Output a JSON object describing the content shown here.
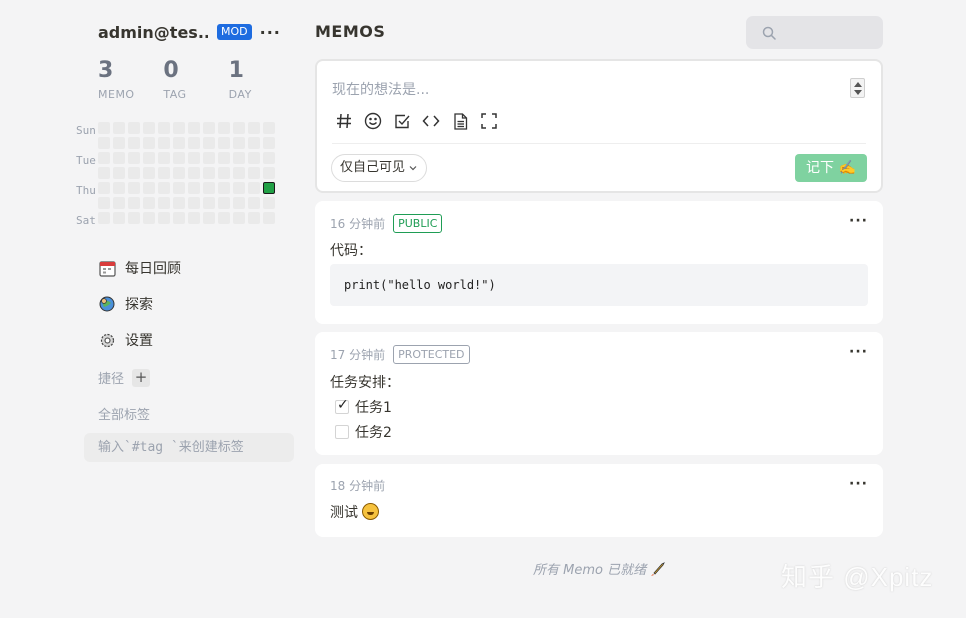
{
  "user": {
    "name": "admin@tes...",
    "role_badge": "MOD",
    "more_label": "···"
  },
  "stats": [
    {
      "value": "3",
      "label": "MEMO"
    },
    {
      "value": "0",
      "label": "TAG"
    },
    {
      "value": "1",
      "label": "DAY"
    }
  ],
  "heatmap": {
    "weekday_labels": [
      "Sun",
      "Tue",
      "Thu",
      "Sat"
    ],
    "rows": 7,
    "columns": 12,
    "active_cells": [
      {
        "row": 4,
        "column": 11
      }
    ],
    "active_color": "#22a046"
  },
  "nav": [
    {
      "label": "每日回顾",
      "icon": "calendar-icon"
    },
    {
      "label": "探索",
      "icon": "explore-icon"
    },
    {
      "label": "设置",
      "icon": "gear-icon"
    }
  ],
  "shortcuts": {
    "label": "捷径",
    "add_label": "+"
  },
  "tags": {
    "all_label": "全部标签",
    "hint": "输入`#tag `来创建标签"
  },
  "header": {
    "title": "MEMOS",
    "search_placeholder": ""
  },
  "editor": {
    "placeholder": "现在的想法是...",
    "toolbar": [
      "hashtag-icon",
      "emoji-icon",
      "checkbox-icon",
      "code-icon",
      "file-icon",
      "fullscreen-icon"
    ],
    "visibility": "仅自己可见",
    "save_label": "记下 ✍️",
    "save_color": "#7fd2a0"
  },
  "memos": [
    {
      "time": "16 分钟前",
      "visibility": "PUBLIC",
      "text": "代码：",
      "code": "print(\"hello world!\")"
    },
    {
      "time": "17 分钟前",
      "visibility": "PROTECTED",
      "text": "任务安排：",
      "tasks": [
        {
          "label": "任务1",
          "done": true
        },
        {
          "label": "任务2",
          "done": false
        }
      ]
    },
    {
      "time": "18 分钟前",
      "visibility": "",
      "text": "测试"
    }
  ],
  "memo_more_label": "···",
  "footer": {
    "note": "所有 Memo 已就绪"
  },
  "watermark": "知乎 @Xpitz"
}
